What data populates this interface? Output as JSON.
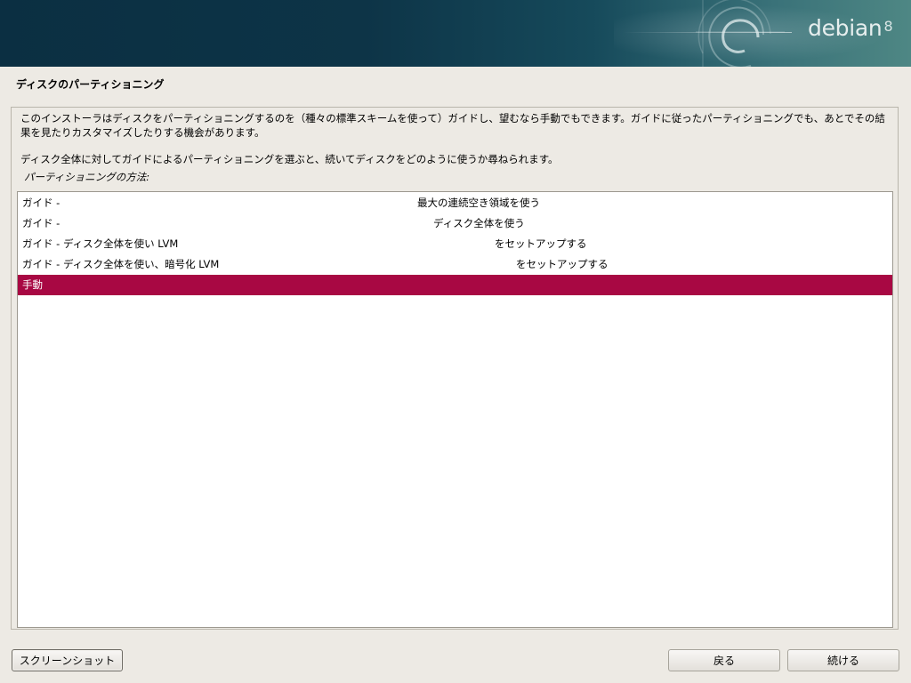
{
  "banner": {
    "brand": "debian",
    "version": "8"
  },
  "page": {
    "title": "ディスクのパーティショニング"
  },
  "description": {
    "paragraph1": "このインストーラはディスクをパーティショニングするのを（種々の標準スキームを使って）ガイドし、望むなら手動でもできます。ガイドに従ったパーティショニングでも、あとでその結果を見たりカスタマイズしたりする機会があります。",
    "paragraph2": "ディスク全体に対してガイドによるパーティショニングを選ぶと、続いてディスクをどのように使うか尋ねられます。"
  },
  "method": {
    "label": "パーティショニングの方法:",
    "items": [
      {
        "left": "ガイド -",
        "right": "最大の連続空き領域を使う",
        "selected": false
      },
      {
        "left": "ガイド -",
        "right": "ディスク全体を使う",
        "selected": false
      },
      {
        "left": "ガイド - ディスク全体を使い LVM",
        "right": "をセットアップする",
        "selected": false
      },
      {
        "left": "ガイド - ディスク全体を使い、暗号化 LVM",
        "right": "をセットアップする",
        "selected": false
      },
      {
        "left": "手動",
        "right": "",
        "selected": true
      }
    ]
  },
  "buttons": {
    "screenshot": "スクリーンショット",
    "back": "戻る",
    "continue": "続ける"
  },
  "colors": {
    "selection": "#a80843",
    "background": "#edeae4",
    "banner": "#0d3447"
  }
}
